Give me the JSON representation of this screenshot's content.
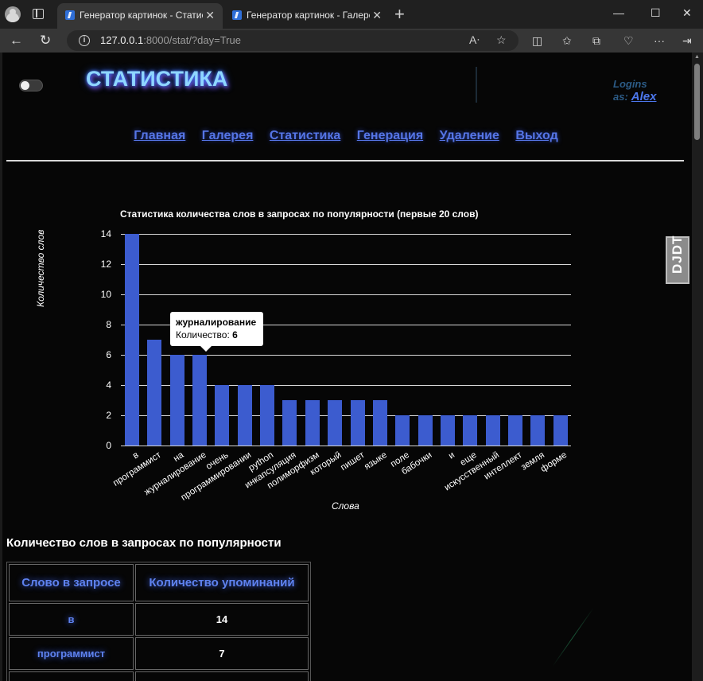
{
  "browser": {
    "tabs": [
      {
        "title": "Генератор картинок - Статистика",
        "active": true
      },
      {
        "title": "Генератор картинок - Галерея картинок",
        "active": false
      }
    ],
    "url_host": "127.0.0.1",
    "url_rest": ":8000/stat/?day=True"
  },
  "header": {
    "title": "СТАТИСТИКА",
    "login_prefix": "Logins as:",
    "username": "Alex"
  },
  "nav": [
    "Главная",
    "Галерея",
    "Статистика",
    "Генерация",
    "Удаление",
    "Выход"
  ],
  "extension_badge": "DJDT",
  "chart_data": {
    "type": "bar",
    "title": "Статистика количества слов в запросах по популярности (первые 20 слов)",
    "xlabel": "Слова",
    "ylabel": "Количество слов",
    "ylim": [
      0,
      14
    ],
    "yticks": [
      0,
      2,
      4,
      6,
      8,
      10,
      12,
      14
    ],
    "grid": true,
    "color": "#3c5ccf",
    "categories": [
      "в",
      "программист",
      "на",
      "журналирование",
      "очень",
      "программировании",
      "python",
      "инкапсуляция",
      "полиморфизм",
      "который",
      "пишет",
      "языке",
      "поле",
      "бабочки",
      "и",
      "еще",
      "искусственный",
      "интеллект",
      "земля",
      "форме"
    ],
    "values": [
      14,
      7,
      6,
      6,
      4,
      4,
      4,
      3,
      3,
      3,
      3,
      3,
      2,
      2,
      2,
      2,
      2,
      2,
      2,
      2
    ],
    "tooltip": {
      "word": "журналирование",
      "label": "Количество:",
      "value": "6"
    }
  },
  "table": {
    "title": "Количество слов в запросах по популярности",
    "headers": [
      "Слово в запросе",
      "Количество упоминаний"
    ],
    "rows": [
      {
        "word": "в",
        "count": "14"
      },
      {
        "word": "программист",
        "count": "7"
      }
    ]
  }
}
